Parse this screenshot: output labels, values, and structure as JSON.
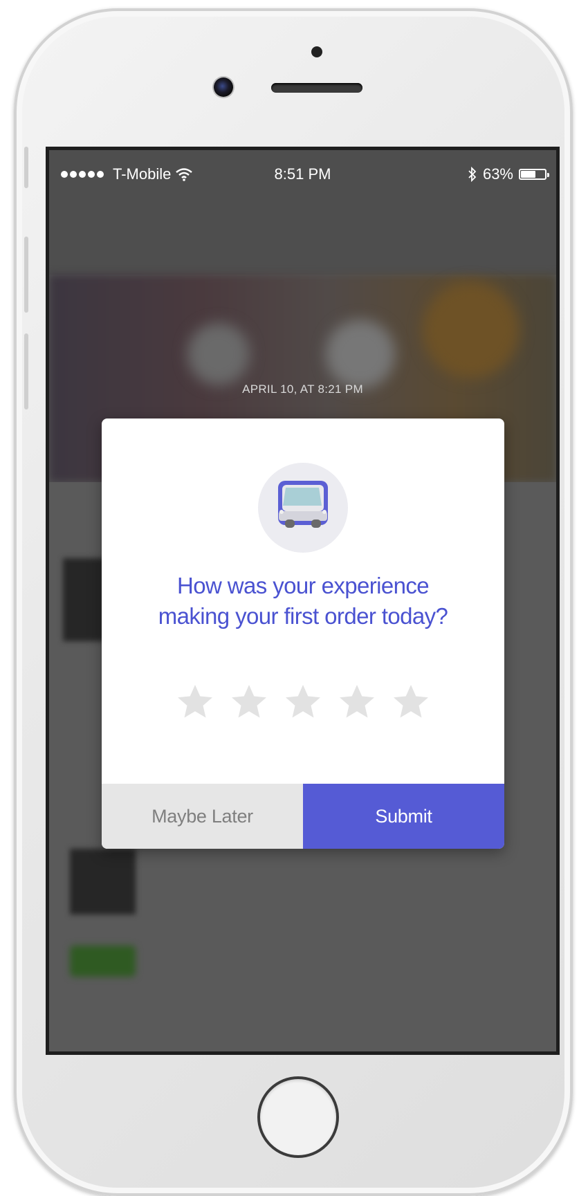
{
  "status_bar": {
    "carrier": "T-Mobile",
    "time": "8:51 PM",
    "battery": "63%",
    "battery_level": 0.63
  },
  "background": {
    "date_label": "APRIL 10, AT 8:21 PM"
  },
  "modal": {
    "icon": "delivery-truck-icon",
    "question_line1": "How was your experience",
    "question_line2": "making your first order today?",
    "rating": {
      "max": 5,
      "value": 0
    },
    "maybe_later_label": "Maybe Later",
    "submit_label": "Submit"
  },
  "colors": {
    "accent": "#555bd5",
    "question_text": "#4a52d1",
    "star_empty": "#e2e2e2",
    "secondary_button": "#e6e6e6"
  }
}
